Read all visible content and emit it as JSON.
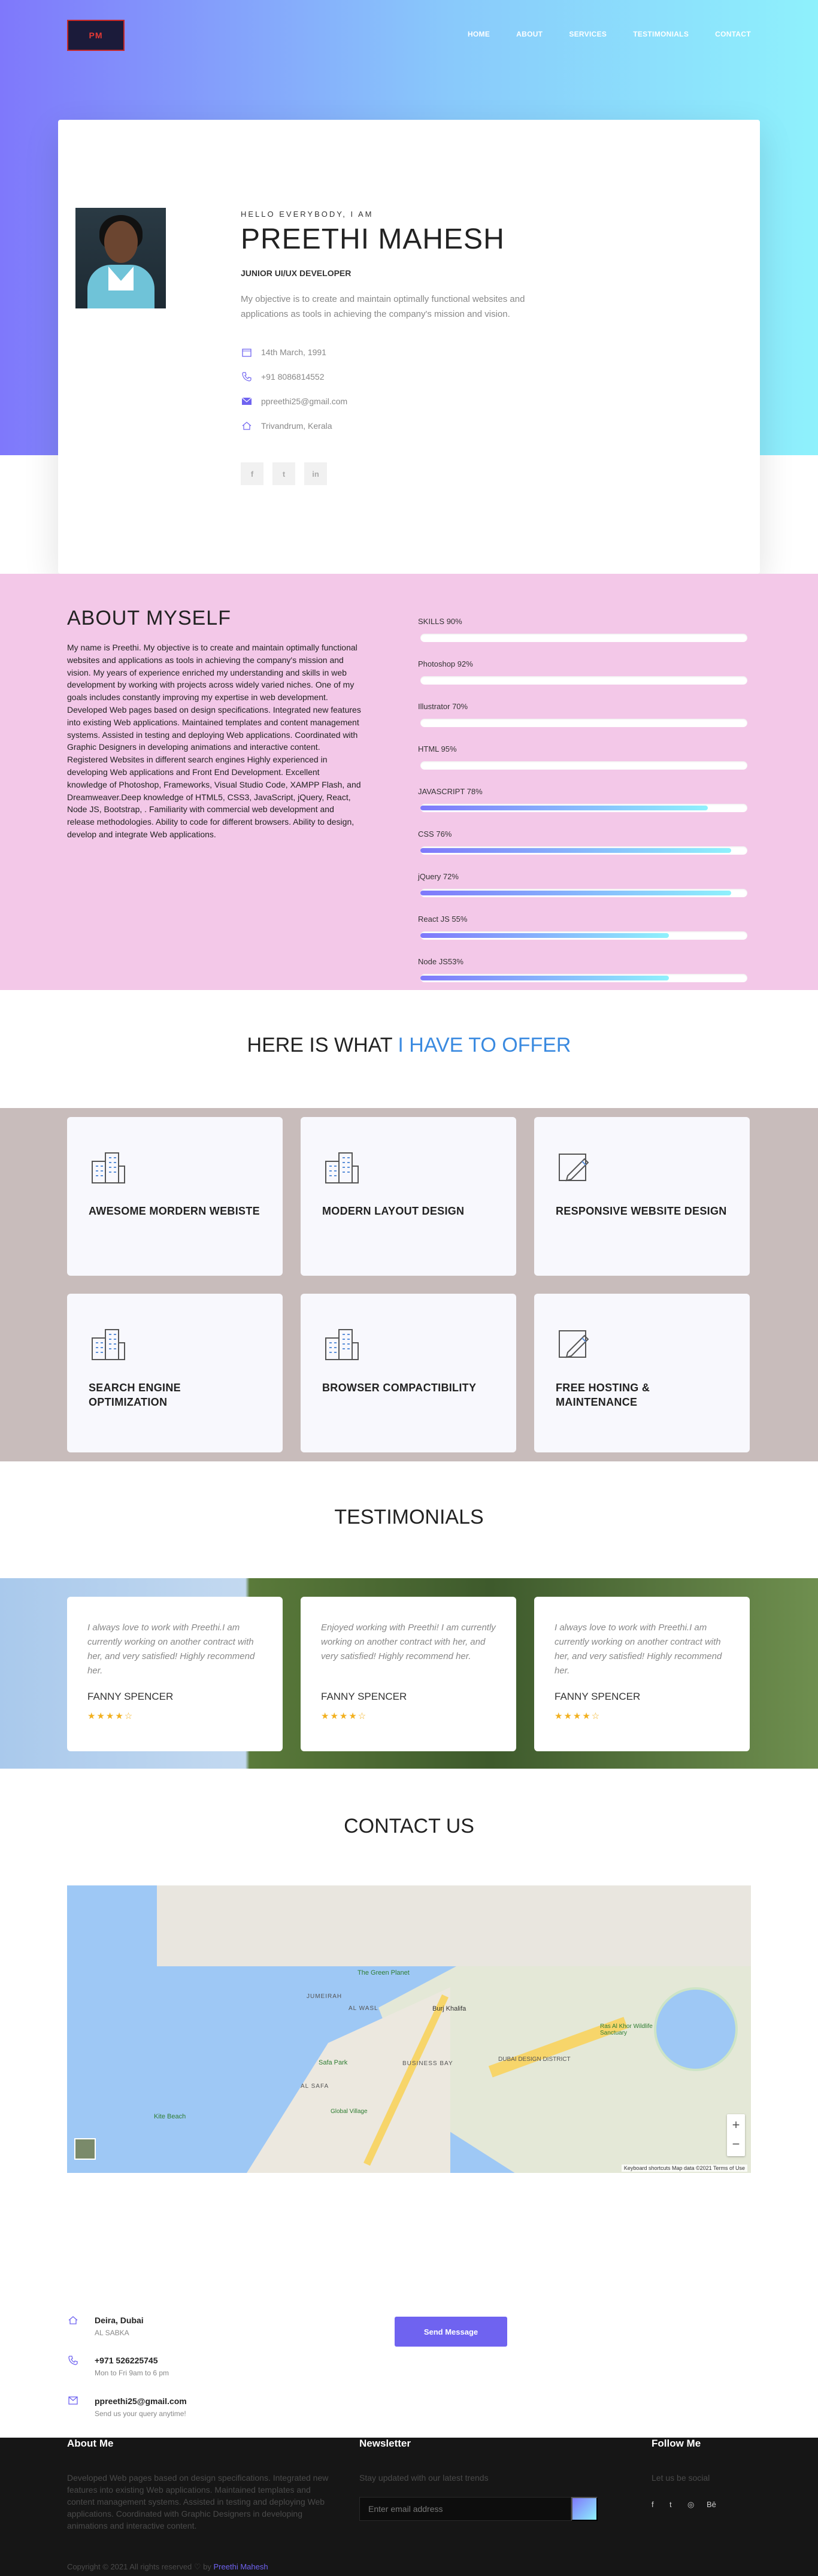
{
  "header": {
    "logo_text": "PM",
    "nav": [
      "HOME",
      "ABOUT",
      "SERVICES",
      "TESTIMONIALS",
      "CONTACT"
    ]
  },
  "profile": {
    "greeting": "HELLO EVERYBODY, I AM",
    "name": "PREETHI MAHESH",
    "role": "JUNIOR UI/UX DEVELOPER",
    "objective": "My objective is to create and maintain optimally functional websites and applications as tools in achieving the company's mission and vision.",
    "dob": "14th March, 1991",
    "phone": "+91 8086814552",
    "email": "ppreethi25@gmail.com",
    "location": "Trivandrum, Kerala",
    "social": [
      "f",
      "t",
      "in"
    ]
  },
  "about": {
    "title": "ABOUT MYSELF",
    "text": "My name is Preethi. My objective is to create and maintain optimally functional websites and applications as tools in achieving the company's mission and vision. My years of experience enriched my understanding and skills in web development by working with projects across widely varied niches. One of my goals includes constantly improving my expertise in web development. Developed Web pages based on design specifications. Integrated new features into existing Web applications. Maintained templates and content management systems. Assisted in testing and deploying Web applications. Coordinated with Graphic Designers in developing animations and interactive content. Registered Websites in different search engines Highly experienced in developing Web applications and Front End Development. Excellent knowledge of Photoshop, Frameworks, Visual Studio Code, XAMPP Flash, and Dreamweaver.Deep knowledge of HTML5, CSS3, JavaScript, jQuery, React, Node JS, Bootstrap, . Familiarity with commercial web development and release methodologies. Ability to code for different browsers. Ability to design, develop and integrate Web applications.",
    "skills": [
      {
        "label": "SKILLS 90%",
        "value": 0
      },
      {
        "label": "Photoshop 92%",
        "value": 0
      },
      {
        "label": "Illustrator 70%",
        "value": 0
      },
      {
        "label": "HTML 95%",
        "value": 0
      },
      {
        "label": "JAVASCRIPT 78%",
        "value": 88
      },
      {
        "label": "CSS 76%",
        "value": 95
      },
      {
        "label": "jQuery 72%",
        "value": 95
      },
      {
        "label": "React JS 55%",
        "value": 76
      },
      {
        "label": "Node JS53%",
        "value": 76
      }
    ]
  },
  "offer": {
    "title_a": "HERE IS WHAT ",
    "title_b": "I HAVE TO OFFER",
    "services": [
      {
        "title": "AWESOME MORDERN WEBISTE",
        "icon": "building-icon"
      },
      {
        "title": "MODERN LAYOUT DESIGN",
        "icon": "building-icon"
      },
      {
        "title": "RESPONSIVE WEBSITE DESIGN",
        "icon": "pencil-icon"
      },
      {
        "title": "SEARCH ENGINE OPTIMIZATION",
        "icon": "building-icon"
      },
      {
        "title": "BROWSER COMPACTIBILITY",
        "icon": "building-icon"
      },
      {
        "title": "FREE HOSTING & MAINTENANCE",
        "icon": "pencil-icon"
      }
    ]
  },
  "testimonials": {
    "title": "TESTIMONIALS",
    "items": [
      {
        "quote": "I always love to work with Preethi.I am currently working on another contract with her, and very satisfied! Highly recommend her.",
        "name": "FANNY SPENCER",
        "stars": "★★★★☆"
      },
      {
        "quote": "Enjoyed working with Preethi! I am currently working on another contract with her, and very satisfied! Highly recommend her.",
        "name": "FANNY SPENCER",
        "stars": "★★★★☆"
      },
      {
        "quote": "I always love to work with Preethi.I am currently working on another contract with her, and very satisfied! Highly recommend her.",
        "name": "FANNY SPENCER",
        "stars": "★★★★☆"
      }
    ]
  },
  "contact": {
    "title": "CONTACT US",
    "map_labels": [
      "The Green Planet",
      "Burj Khalifa",
      "AL WASL",
      "JUMEIRAH",
      "BUSINESS BAY",
      "DUBAI DESIGN DISTRICT",
      "Ras Al Khor Wildlife Sanctuary",
      "AL SAFA",
      "Safa Park",
      "Kite Beach",
      "Global Village"
    ],
    "map_footer": "Keyboard shortcuts   Map data ©2021   Terms of Use",
    "address_title": "Deira, Dubai",
    "address_sub": "AL SABKA",
    "phone_title": "+971 526225745",
    "phone_sub": "Mon to Fri 9am to 6 pm",
    "email_title": "ppreethi25@gmail.com",
    "email_sub": "Send us your query anytime!",
    "send_label": "Send Message"
  },
  "footer": {
    "about_title": "About Me",
    "about_text": "Developed Web pages based on design specifications. Integrated new features into existing Web applications. Maintained templates and content management systems. Assisted in testing and deploying Web applications. Coordinated with Graphic Designers in developing animations and interactive content.",
    "newsletter_title": "Newsletter",
    "newsletter_text": "Stay updated with our latest trends",
    "email_placeholder": "Enter email address",
    "follow_title": "Follow Me",
    "follow_text": "Let us be social",
    "social": [
      "f",
      "t",
      "◎",
      "Bē"
    ],
    "copyright": "Copyright © 2021 All rights reserved ♡ by ",
    "copyright_name": "Preethi Mahesh"
  },
  "colors": {
    "accent": "#6f63f0",
    "gradient_start": "#7f78fb",
    "gradient_end": "#8ef1fc",
    "about_bg": "#f3c8e8",
    "offer_bg": "#c8bcbb"
  }
}
